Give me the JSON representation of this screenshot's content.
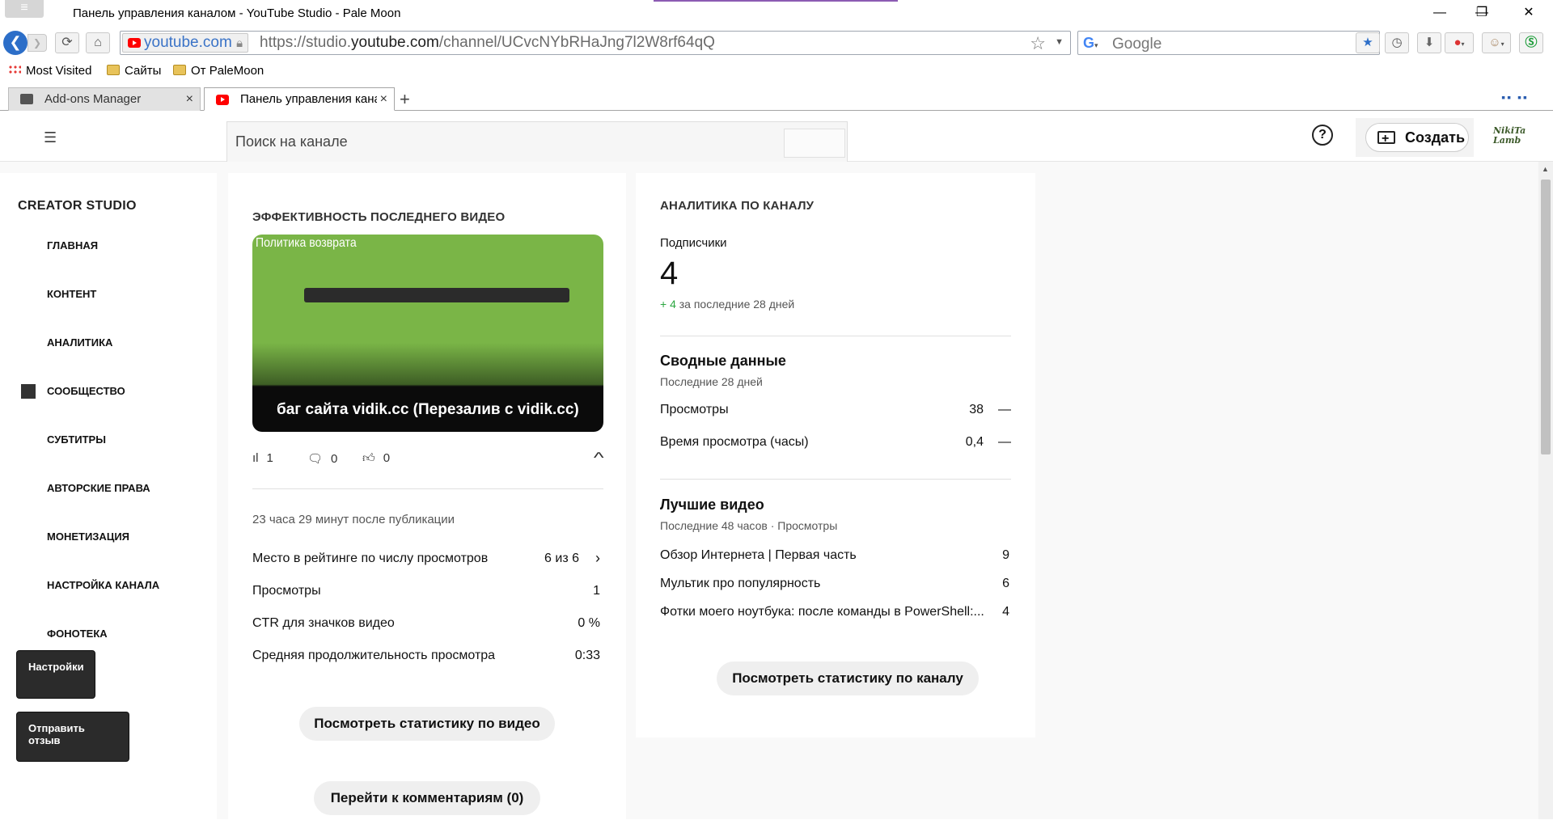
{
  "browser": {
    "menu_label": "≡",
    "window_title": "Панель управления каналом - YouTube Studio - Pale Moon",
    "controls": {
      "minimize": "—",
      "restore": "❐",
      "close": "✕"
    },
    "url_site": "youtube.com",
    "url_prefix": "https://studio.",
    "url_domain": "youtube.com",
    "url_path": "/channel/UCvcNYbRHaJng7l2W8rf64qQ",
    "search_placeholder": "Google",
    "bookmarks": [
      "Most Visited",
      "Сайты",
      "От PaleMoon"
    ],
    "tabs": [
      {
        "label": "Add-ons Manager"
      },
      {
        "label": "Панель управления кана"
      }
    ]
  },
  "header": {
    "search_placeholder": "Поиск на канале",
    "help": "?",
    "create_label": "Создать",
    "avatar_text": "NikiTa Lamb"
  },
  "sidebar": {
    "title": "CREATOR STUDIO",
    "items": [
      "ГЛАВНАЯ",
      "КОНТЕНТ",
      "АНАЛИТИКА",
      "СООБЩЕСТВО",
      "СУБТИТРЫ",
      "АВТОРСКИЕ ПРАВА",
      "МОНЕТИЗАЦИЯ",
      "НАСТРОЙКА КАНАЛА",
      "ФОНОТЕКА"
    ],
    "settings_label": "Настройки",
    "feedback_label": "Отправить отзыв"
  },
  "last_video": {
    "title": "ЭФФЕКТИВНОСТЬ ПОСЛЕДНЕГО ВИДЕО",
    "thumb_label": "Политика возврата",
    "caption": "баг сайта vidik.cc (Перезалив с vidik.cc)",
    "views_count": "1",
    "comments_count": "0",
    "likes_count": "0",
    "since_publish": "23 часа 29 минут после публикации",
    "rows": [
      {
        "label": "Место в рейтинге по числу просмотров",
        "value": "6 из 6"
      },
      {
        "label": "Просмотры",
        "value": "1"
      },
      {
        "label": "CTR для значков видео",
        "value": "0 %"
      },
      {
        "label": "Средняя продолжительность просмотра",
        "value": "0:33"
      }
    ],
    "video_stats_button": "Посмотреть статистику по видео",
    "comments_button": "Перейти к комментариям (0)"
  },
  "channel_analytics": {
    "title": "АНАЛИТИКА ПО КАНАЛУ",
    "subscribers_label": "Подписчики",
    "subscribers_value": "4",
    "subscribers_delta": "+ 4",
    "subscribers_period": "за последние 28 дней",
    "summary_title": "Сводные данные",
    "summary_period": "Последние 28 дней",
    "summary_rows": [
      {
        "label": "Просмотры",
        "value": "38",
        "trend": "—"
      },
      {
        "label": "Время просмотра (часы)",
        "value": "0,4",
        "trend": "—"
      }
    ],
    "top_title": "Лучшие видео",
    "top_period": "Последние 48 часов · Просмотры",
    "top_videos": [
      {
        "label": "Обзор Интернета | Первая часть",
        "value": "9"
      },
      {
        "label": "Мультик про популярность",
        "value": "6"
      },
      {
        "label": "Фотки моего ноутбука: после команды в PowerShell:...",
        "value": "4"
      }
    ],
    "stats_button": "Посмотреть статистику по каналу"
  },
  "colors": {
    "accent_green": "#2ba640",
    "thumb_green": "#7ab547",
    "browser_blue": "#2c6ec8"
  }
}
